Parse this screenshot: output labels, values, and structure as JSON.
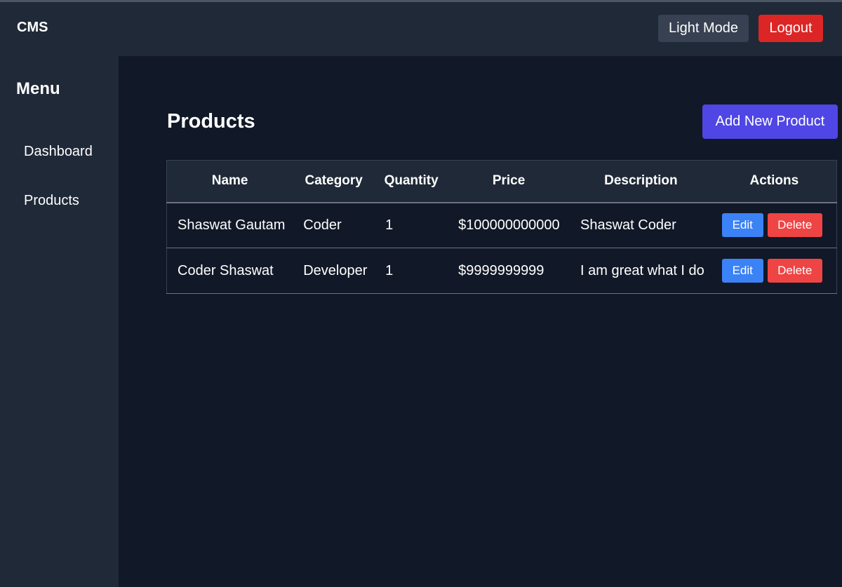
{
  "header": {
    "brand": "CMS",
    "light_mode_label": "Light Mode",
    "logout_label": "Logout"
  },
  "sidebar": {
    "title": "Menu",
    "items": [
      {
        "label": "Dashboard"
      },
      {
        "label": "Products"
      }
    ]
  },
  "main": {
    "title": "Products",
    "add_label": "Add New Product",
    "table": {
      "columns": [
        "Name",
        "Category",
        "Quantity",
        "Price",
        "Description",
        "Actions"
      ],
      "rows": [
        {
          "name": "Shaswat Gautam",
          "category": "Coder",
          "quantity": "1",
          "price": "$100000000000",
          "description": "Shaswat Coder",
          "edit": "Edit",
          "delete": "Delete"
        },
        {
          "name": "Coder Shaswat",
          "category": "Developer",
          "quantity": "1",
          "price": "$9999999999",
          "description": "I am great what I do",
          "edit": "Edit",
          "delete": "Delete"
        }
      ]
    }
  },
  "colors": {
    "background": "#111827",
    "panel": "#1f2937",
    "accent": "#4f46e5",
    "edit": "#3b82f6",
    "delete": "#ef4444",
    "logout": "#dc2626"
  }
}
